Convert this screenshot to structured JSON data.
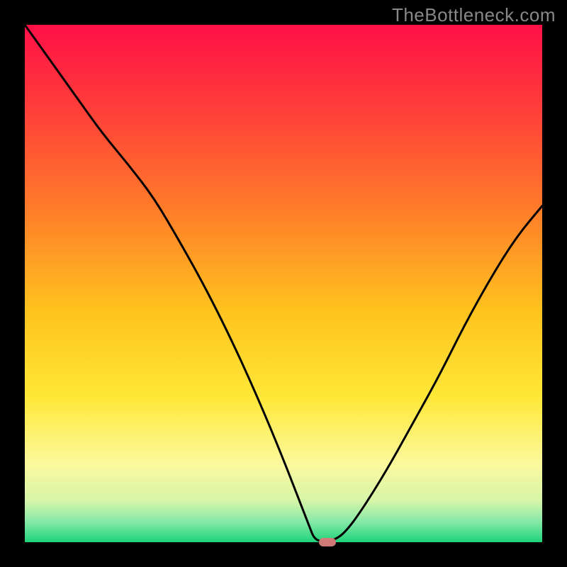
{
  "watermark": "TheBottleneck.com",
  "chart_data": {
    "type": "line",
    "title": "",
    "xlabel": "",
    "ylabel": "",
    "xlim": [
      0,
      100
    ],
    "ylim": [
      0,
      100
    ],
    "x": [
      0,
      5,
      10,
      15,
      20,
      25,
      30,
      35,
      40,
      45,
      50,
      55,
      56,
      58,
      60,
      62,
      65,
      70,
      75,
      80,
      85,
      90,
      95,
      100
    ],
    "values": [
      100,
      93,
      86,
      79,
      73,
      66.5,
      58,
      49,
      39,
      28,
      16,
      3,
      0.5,
      0,
      0.5,
      2,
      6,
      14,
      23,
      32,
      42,
      51,
      59,
      65
    ],
    "gradient_stops": [
      {
        "pos": 0.0,
        "color": "#ff1048"
      },
      {
        "pos": 0.15,
        "color": "#ff3a3a"
      },
      {
        "pos": 0.35,
        "color": "#ff7a2a"
      },
      {
        "pos": 0.55,
        "color": "#ffc21e"
      },
      {
        "pos": 0.72,
        "color": "#ffe838"
      },
      {
        "pos": 0.85,
        "color": "#fbf99e"
      },
      {
        "pos": 0.92,
        "color": "#d6f5a8"
      },
      {
        "pos": 0.96,
        "color": "#86e9a8"
      },
      {
        "pos": 1.0,
        "color": "#1ed37a"
      }
    ],
    "marker": {
      "x": 58.5,
      "y": 0
    }
  },
  "colors": {
    "frame": "#000000",
    "curve": "#000000",
    "marker": "#cf7a77",
    "watermark": "#888888"
  }
}
